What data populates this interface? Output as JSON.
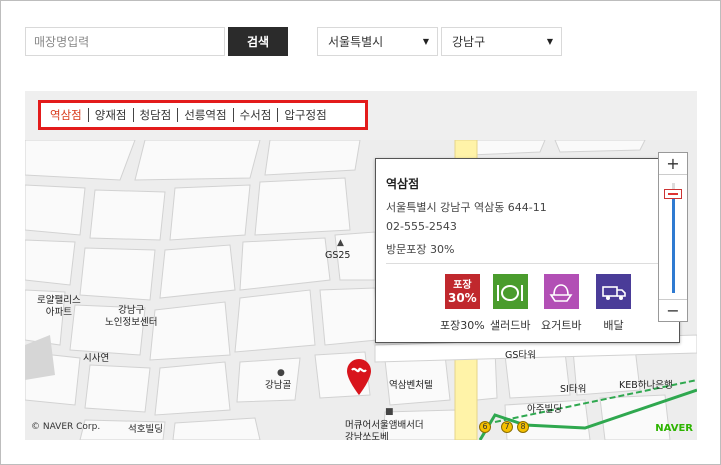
{
  "search": {
    "placeholder": "매장명입력",
    "button_label": "검색"
  },
  "filters": {
    "city": "서울특별시",
    "district": "강남구"
  },
  "tabs": [
    {
      "label": "역삼점",
      "active": true
    },
    {
      "label": "양재점",
      "active": false
    },
    {
      "label": "청담점",
      "active": false
    },
    {
      "label": "선릉역점",
      "active": false
    },
    {
      "label": "수서점",
      "active": false
    },
    {
      "label": "압구정점",
      "active": false
    }
  ],
  "store": {
    "name": "역삼점",
    "address": "서울특별시 강남구 역삼동 644-11",
    "phone": "02-555-2543",
    "discount": "방문포장 30%",
    "amenities": [
      {
        "label": "포장30%",
        "icon": "takeout-30-icon",
        "color": "#c0282d",
        "badge_line1": "포장",
        "badge_line2": "30%"
      },
      {
        "label": "샐러드바",
        "icon": "salad-bar-icon",
        "color": "#4a9c2d"
      },
      {
        "label": "요거트바",
        "icon": "yogurt-bar-icon",
        "color": "#b24fb5"
      },
      {
        "label": "배달",
        "icon": "delivery-icon",
        "color": "#4a3c98"
      }
    ]
  },
  "zoom": {
    "level": 0.9
  },
  "map": {
    "labels": {
      "gs25": "GS25",
      "royal_palace_1": "로얄팰리스",
      "royal_palace_2": "아파트",
      "senior_center_1": "강남구",
      "senior_center_2": "노인정보센터",
      "sasayeon": "시사연",
      "gangnamgol": "강남골",
      "yeoksam_venture": "역삼벤처텔",
      "gs_tower": "GS타워",
      "si_tower": "SI타워",
      "keb": "KEB하나은행",
      "aju": "아주빌딩",
      "mercure_1": "머큐어서울앰배서더",
      "mercure_2": "강남쏘도베",
      "seokho": "석호빌딩",
      "bus_6": "6",
      "bus_7": "7",
      "bus_8": "8"
    },
    "copyright": "© NAVER Corp.",
    "logo": "NAVER"
  },
  "colors": {
    "accent_red": "#e31b1b",
    "active_tab": "#d93a1c",
    "pin_red": "#d8141c"
  }
}
